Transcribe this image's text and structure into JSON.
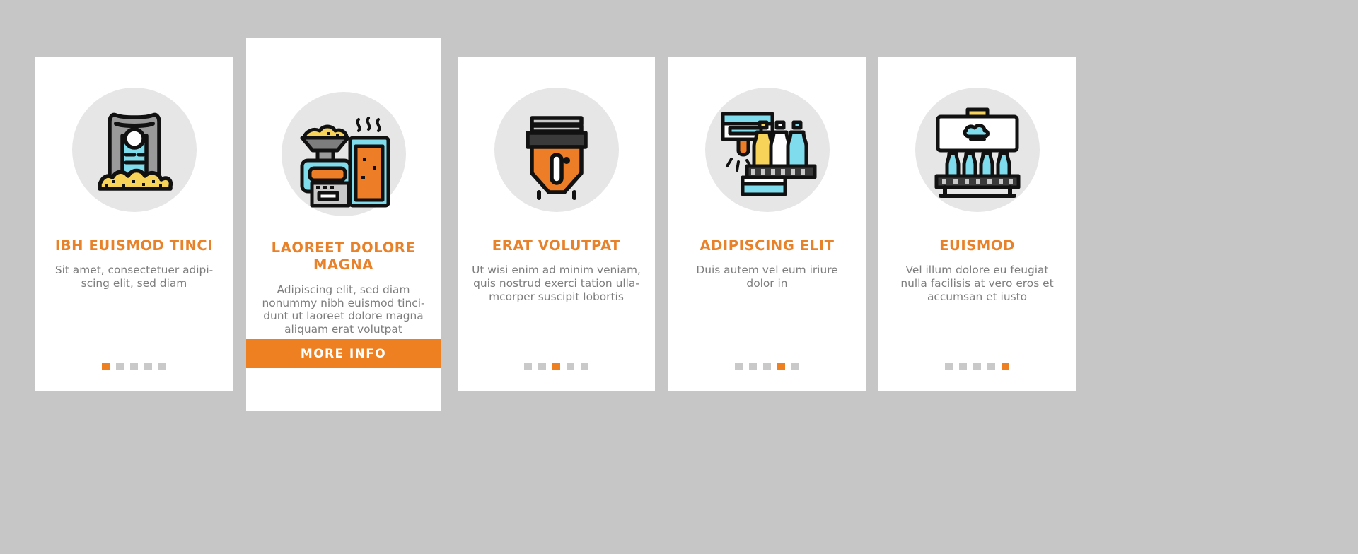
{
  "theme": {
    "background": "#c6c6c6",
    "card_background": "#ffffff",
    "accent": "#ef8022",
    "title_color": "#e8822a",
    "body_color": "#7d7d7d",
    "icon_circle": "#e6e6e6",
    "dot_inactive": "#c9c9c9"
  },
  "cards": [
    {
      "icon": "grain-sack-icon",
      "title": "IBH EUISMOD TINCI",
      "body": "Sit amet, consectetuer adipi-scing elit, sed diam",
      "dots": {
        "count": 5,
        "active": 1
      },
      "featured": false
    },
    {
      "icon": "mash-tun-brewing-icon",
      "title": "LAOREET DOLORE MAGNA",
      "body": "Adipiscing elit, sed diam nonummy nibh euismod tinci-dunt ut laoreet dolore magna aliquam erat volutpat",
      "button_label": "MORE INFO",
      "featured": true
    },
    {
      "icon": "fermentation-tank-icon",
      "title": "ERAT VOLUTPAT",
      "body": "Ut wisi enim ad minim veniam, quis nostrud exerci tation ulla-mcorper suscipit lobortis",
      "dots": {
        "count": 5,
        "active": 3
      },
      "featured": false
    },
    {
      "icon": "bottle-filling-icon",
      "title": "ADIPISCING ELIT",
      "body": "Duis autem vel eum iriure dolor in",
      "dots": {
        "count": 5,
        "active": 4
      },
      "featured": false
    },
    {
      "icon": "bottle-conveyor-icon",
      "title": "EUISMOD",
      "body": "Vel illum dolore eu feugiat nulla facilisis at vero eros et accumsan et iusto",
      "dots": {
        "count": 5,
        "active": 5
      },
      "featured": false
    }
  ]
}
